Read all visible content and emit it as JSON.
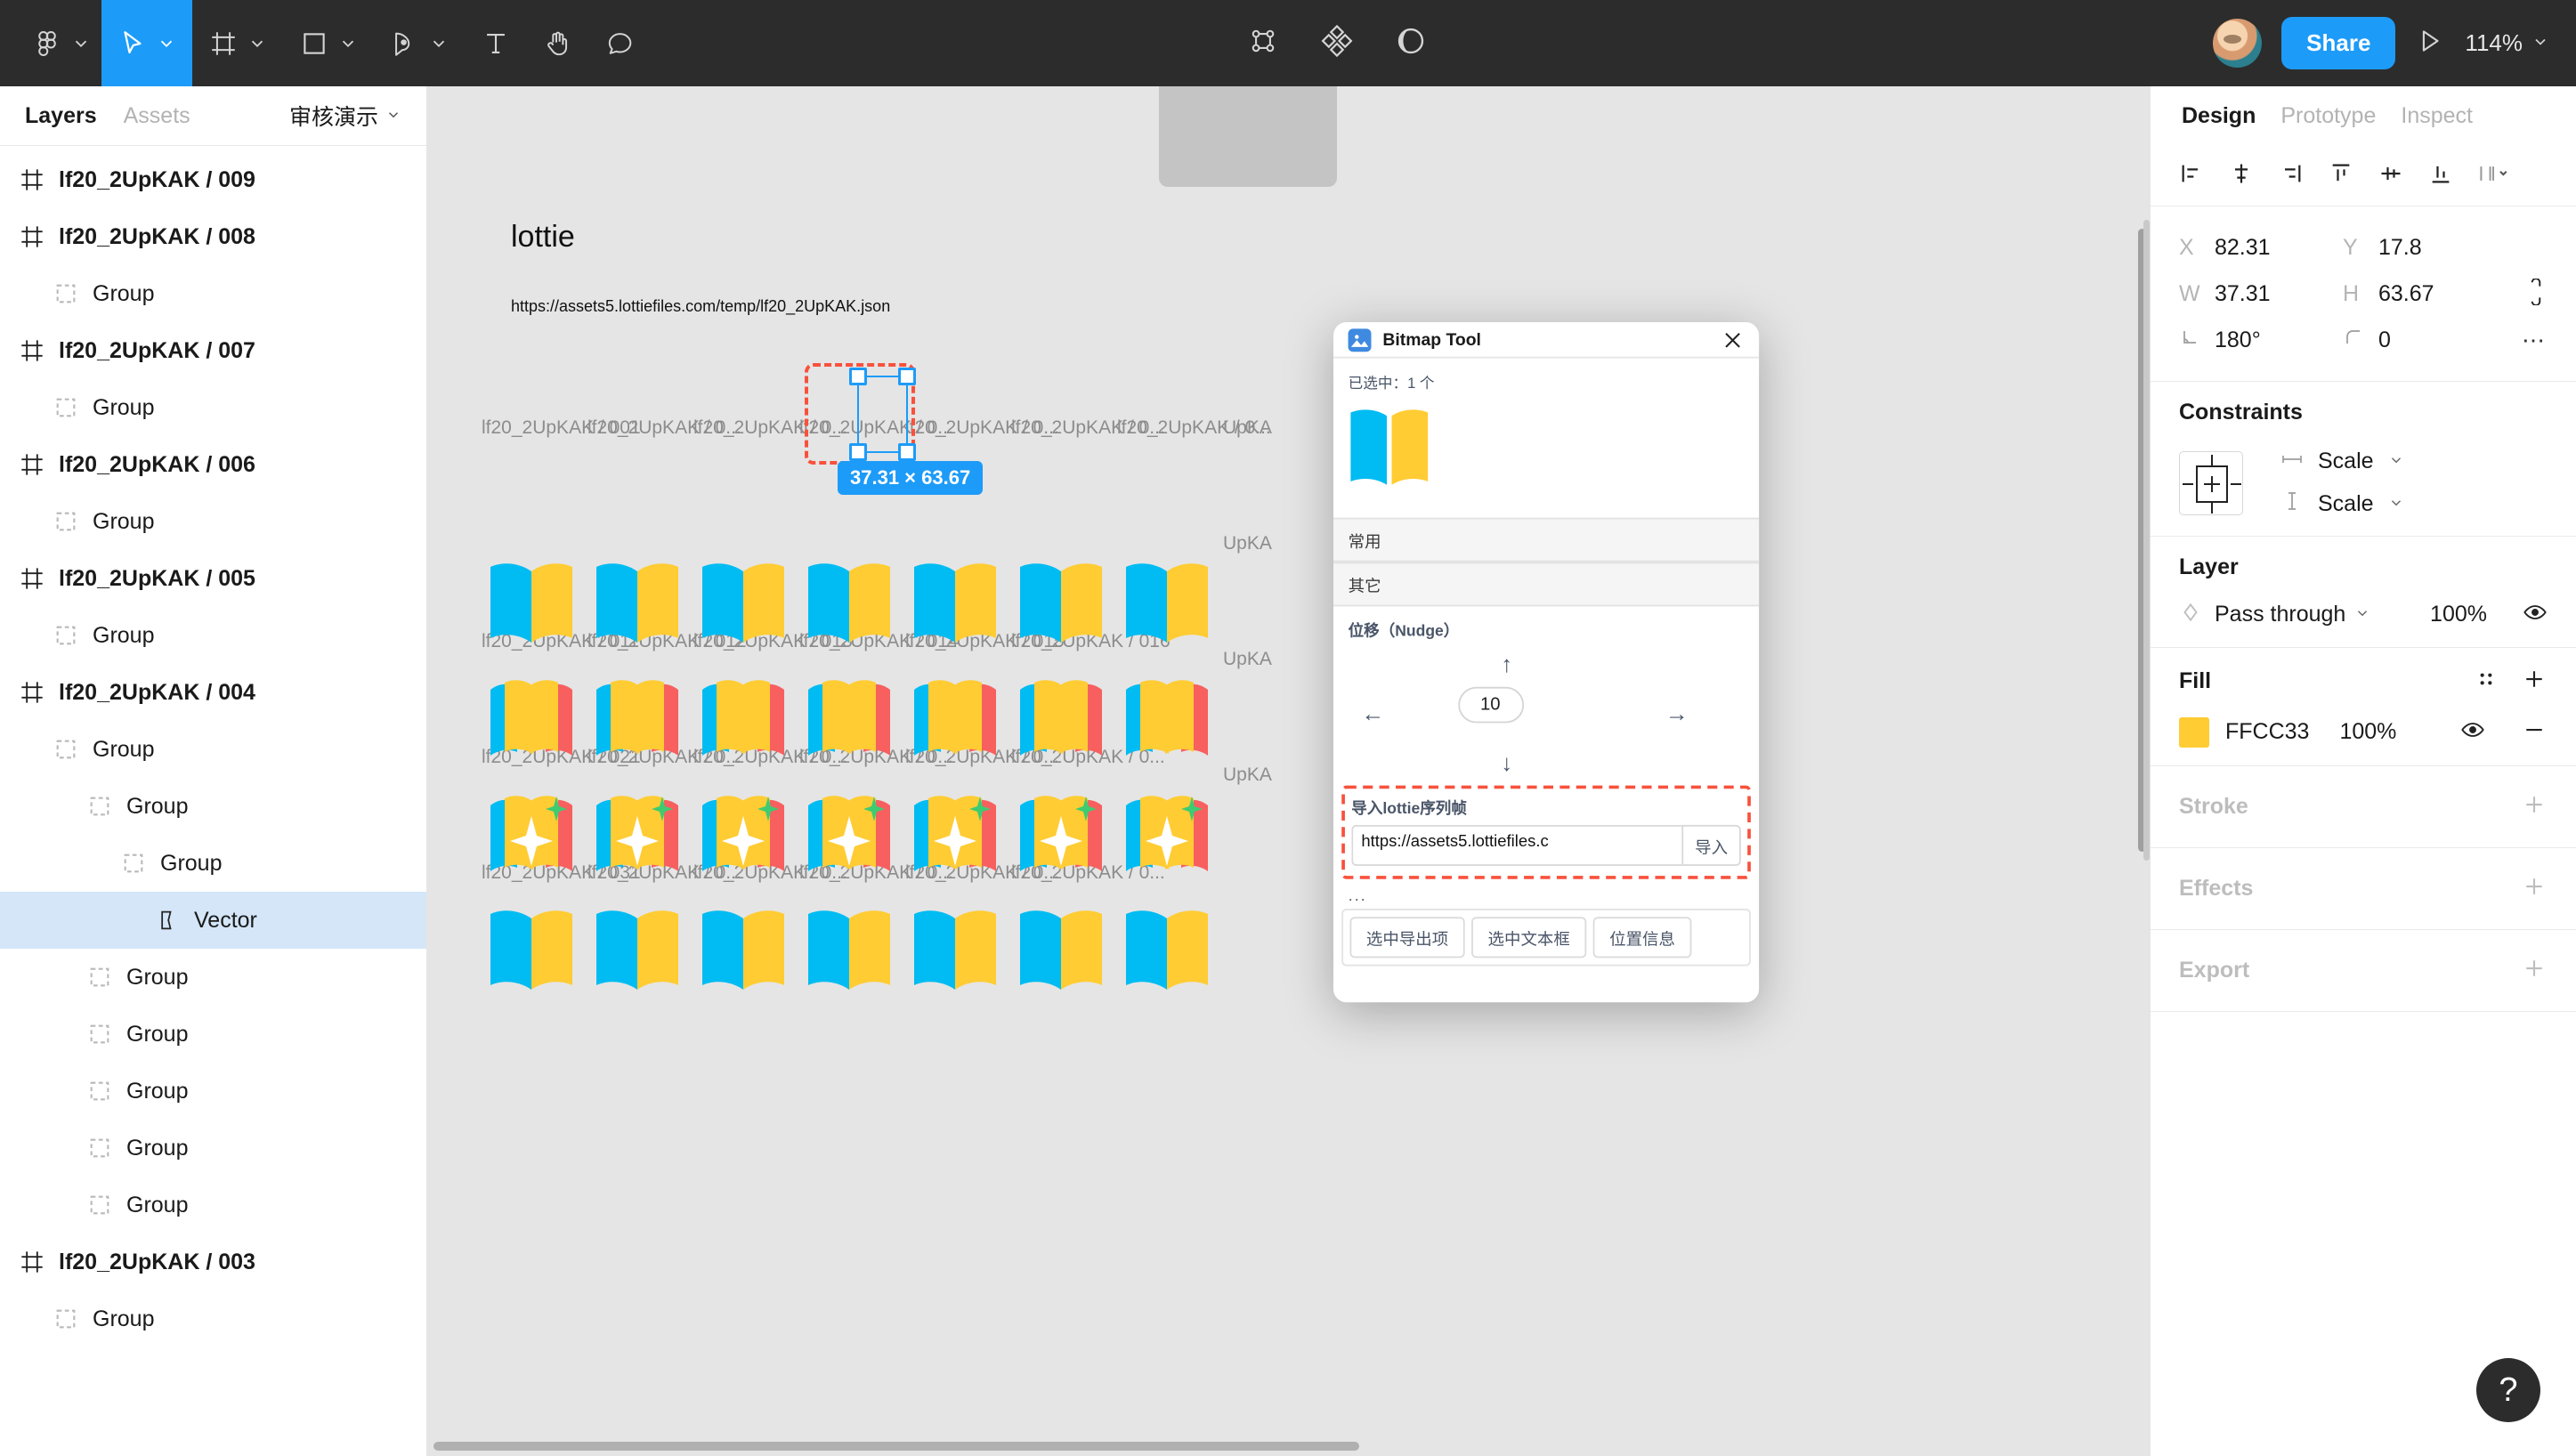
{
  "toolbar": {
    "tools": [
      {
        "name": "figma-menu-icon",
        "label": "Main menu"
      },
      {
        "name": "move-tool-icon",
        "label": "Move"
      },
      {
        "name": "frame-tool-icon",
        "label": "Frame"
      },
      {
        "name": "shape-tool-icon",
        "label": "Rectangle"
      },
      {
        "name": "pen-tool-icon",
        "label": "Pen"
      },
      {
        "name": "text-tool-icon",
        "label": "Text"
      },
      {
        "name": "hand-tool-icon",
        "label": "Hand"
      },
      {
        "name": "comment-tool-icon",
        "label": "Comment"
      }
    ],
    "center_tools": [
      {
        "name": "component-icon",
        "label": "Create component"
      },
      {
        "name": "plugins-icon",
        "label": "Plugins"
      },
      {
        "name": "mask-icon",
        "label": "Mask"
      }
    ],
    "share_label": "Share",
    "present_label": "Present",
    "zoom_level": "114%"
  },
  "left_panel": {
    "tabs": [
      {
        "label": "Layers",
        "active": true
      },
      {
        "label": "Assets",
        "active": false
      }
    ],
    "page_name": "审核演示",
    "layers": [
      {
        "label": "lf20_2UpKAK / 009",
        "type": "frame",
        "depth": 0,
        "selected": false
      },
      {
        "label": "lf20_2UpKAK / 008",
        "type": "frame",
        "depth": 0,
        "selected": false
      },
      {
        "label": "Group",
        "type": "group",
        "depth": 1,
        "selected": false
      },
      {
        "label": "lf20_2UpKAK / 007",
        "type": "frame",
        "depth": 0,
        "selected": false
      },
      {
        "label": "Group",
        "type": "group",
        "depth": 1,
        "selected": false
      },
      {
        "label": "lf20_2UpKAK / 006",
        "type": "frame",
        "depth": 0,
        "selected": false
      },
      {
        "label": "Group",
        "type": "group",
        "depth": 1,
        "selected": false
      },
      {
        "label": "lf20_2UpKAK / 005",
        "type": "frame",
        "depth": 0,
        "selected": false
      },
      {
        "label": "Group",
        "type": "group",
        "depth": 1,
        "selected": false
      },
      {
        "label": "lf20_2UpKAK / 004",
        "type": "frame",
        "depth": 0,
        "selected": false
      },
      {
        "label": "Group",
        "type": "group",
        "depth": 1,
        "selected": false
      },
      {
        "label": "Group",
        "type": "group",
        "depth": 2,
        "selected": false
      },
      {
        "label": "Group",
        "type": "group",
        "depth": 3,
        "selected": false
      },
      {
        "label": "Vector",
        "type": "vector",
        "depth": 4,
        "selected": true
      },
      {
        "label": "Group",
        "type": "group",
        "depth": 2,
        "selected": false
      },
      {
        "label": "Group",
        "type": "group",
        "depth": 2,
        "selected": false
      },
      {
        "label": "Group",
        "type": "group",
        "depth": 2,
        "selected": false
      },
      {
        "label": "Group",
        "type": "group",
        "depth": 2,
        "selected": false
      },
      {
        "label": "Group",
        "type": "group",
        "depth": 2,
        "selected": false
      },
      {
        "label": "lf20_2UpKAK / 003",
        "type": "frame",
        "depth": 0,
        "selected": false
      },
      {
        "label": "Group",
        "type": "group",
        "depth": 1,
        "selected": false
      }
    ]
  },
  "canvas": {
    "title": "lottie",
    "subtitle": "https://assets5.lottiefiles.com/temp/lf20_2UpKAK.json",
    "row1_labels": [
      "lf20_2UpKAK / 001",
      "lf20_2UpKAK / 0...",
      "lf20_2UpKAK / 0...",
      "lf20_2UpKAK / 0...",
      "lf20_2UpKAK / 0...",
      "lf20_2UpKAK / 0...",
      "lf20_2UpKAK / 0..."
    ],
    "row2_labels": [
      "lf20_2UpKAK / 011",
      "lf20_2UpKAK / 012",
      "lf20_2UpKAK / 013",
      "lf20_2UpKAK / 014",
      "lf20_2UpKAK / 015",
      "lf20_2UpKAK / 016"
    ],
    "row3_labels": [
      "lf20_2UpKAK / 021",
      "lf20_2UpKAK / 0...",
      "lf20_2UpKAK / 0...",
      "lf20_2UpKAK / 0...",
      "lf20_2UpKAK / 0...",
      "lf20_2UpKAK / 0..."
    ],
    "row4_labels": [
      "lf20_2UpKAK / 031",
      "lf20_2UpKAK / 0...",
      "lf20_2UpKAK / 0...",
      "lf20_2UpKAK / 0...",
      "lf20_2UpKAK / 0...",
      "lf20_2UpKAK / 0..."
    ],
    "right_edge_labels": [
      "UpKA",
      "UpKA",
      "UpKA",
      "UpKA"
    ],
    "selection_dimensions": "37.31 × 63.67"
  },
  "plugin_dialog": {
    "title": "Bitmap Tool",
    "selection_text": "已选中：1 个",
    "accordion": [
      {
        "label": "常用"
      },
      {
        "label": "其它"
      }
    ],
    "nudge_title": "位移（Nudge）",
    "nudge_value": "10",
    "import_label": "导入lottie序列帧",
    "import_value": "https://assets5.lottiefiles.c",
    "import_placeholder": "https://",
    "import_button": "导入",
    "ellipsis": "...",
    "action_buttons": [
      {
        "label": "选中导出项"
      },
      {
        "label": "选中文本框"
      },
      {
        "label": "位置信息"
      }
    ]
  },
  "right_panel": {
    "tabs": [
      {
        "label": "Design",
        "active": true
      },
      {
        "label": "Prototype",
        "active": false
      },
      {
        "label": "Inspect",
        "active": false
      }
    ],
    "align_icons": [
      {
        "name": "align-left-icon"
      },
      {
        "name": "align-horizontal-center-icon"
      },
      {
        "name": "align-right-icon"
      },
      {
        "name": "align-top-icon"
      },
      {
        "name": "align-vertical-center-icon"
      },
      {
        "name": "align-bottom-icon"
      },
      {
        "name": "distribute-icon"
      }
    ],
    "position": {
      "x_label": "X",
      "x_value": "82.31",
      "y_label": "Y",
      "y_value": "17.8",
      "w_label": "W",
      "w_value": "37.31",
      "h_label": "H",
      "h_value": "63.67",
      "rotation_value": "180°",
      "corner_radius_value": "0"
    },
    "constraints": {
      "title": "Constraints",
      "horizontal": "Scale",
      "vertical": "Scale"
    },
    "layer": {
      "title": "Layer",
      "blend_mode": "Pass through",
      "opacity": "100%"
    },
    "fill": {
      "title": "Fill",
      "color_hex": "FFCC33",
      "color_swatch": "#FFCC33",
      "opacity": "100%"
    },
    "stroke": {
      "title": "Stroke"
    },
    "effects": {
      "title": "Effects"
    },
    "export": {
      "title": "Export"
    },
    "help_label": "?"
  },
  "colors": {
    "accent": "#1d9bf8",
    "toolbar_bg": "#2c2c2c",
    "canvas_bg": "#e5e5e5",
    "selection_dashed": "#f8513c",
    "book_blue": "#00bcf2",
    "book_yellow": "#ffcc33",
    "book_red": "#f7605f",
    "book_green": "#3ecb72"
  }
}
